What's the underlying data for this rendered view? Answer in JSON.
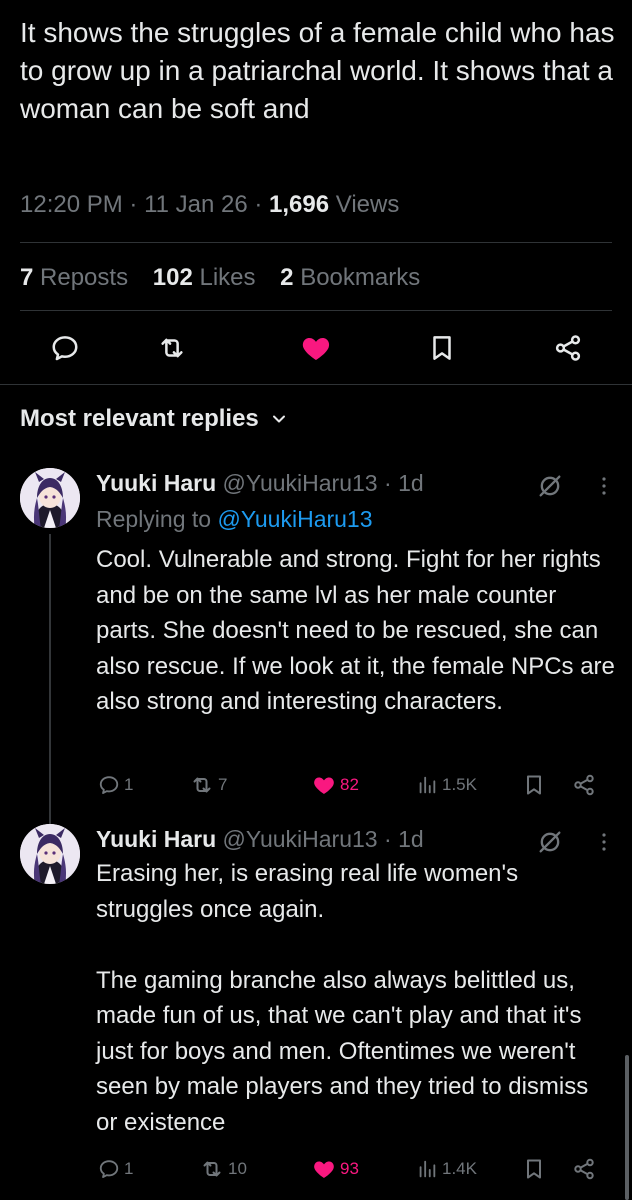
{
  "post": {
    "text": "It shows the struggles of a female child who has to grow up in a patriarchal world. It shows that a woman can be soft and",
    "time": "12:20 PM",
    "date": "11 Jan 26",
    "views_count": "1,696",
    "views_label": "Views",
    "reposts_count": "7",
    "reposts_label": "Reposts",
    "likes_count": "102",
    "likes_label": "Likes",
    "bookmarks_count": "2",
    "bookmarks_label": "Bookmarks"
  },
  "icons": {
    "reply": "speech-bubble",
    "repost": "repost-arrows",
    "like": "heart-filled",
    "bookmark": "bookmark",
    "share": "share-nodes",
    "grok": "slash-circle",
    "more": "vertical-dots",
    "views": "bar-chart"
  },
  "colors": {
    "background": "#000000",
    "text": "#e7e9ea",
    "muted": "#71767b",
    "like": "#f91880",
    "link": "#1d9bf0",
    "divider": "#2f3336"
  },
  "sort": {
    "label": "Most relevant replies"
  },
  "replies": [
    {
      "name": "Yuuki Haru",
      "handle": "@YuukiHaru13",
      "time": "1d",
      "replying_prefix": "Replying to",
      "replying_handle": "@YuukiHaru13",
      "text": "Cool. Vulnerable and strong. Fight for her rights and be on the same lvl as her male counter parts. She doesn't need to be rescued, she can also rescue. If we look at it, the female NPCs are also strong and interesting characters.",
      "reply_count": "1",
      "repost_count": "7",
      "like_count": "82",
      "view_count": "1.5K"
    },
    {
      "name": "Yuuki Haru",
      "handle": "@YuukiHaru13",
      "time": "1d",
      "text": "Erasing her, is erasing real life women's struggles once again.\n\nThe gaming branche also always belittled us, made fun of us, that we can't play and that it's just for boys and men. Oftentimes we weren't seen by male players and they tried to dismiss or existence",
      "reply_count": "1",
      "repost_count": "10",
      "like_count": "93",
      "view_count": "1.4K"
    }
  ]
}
